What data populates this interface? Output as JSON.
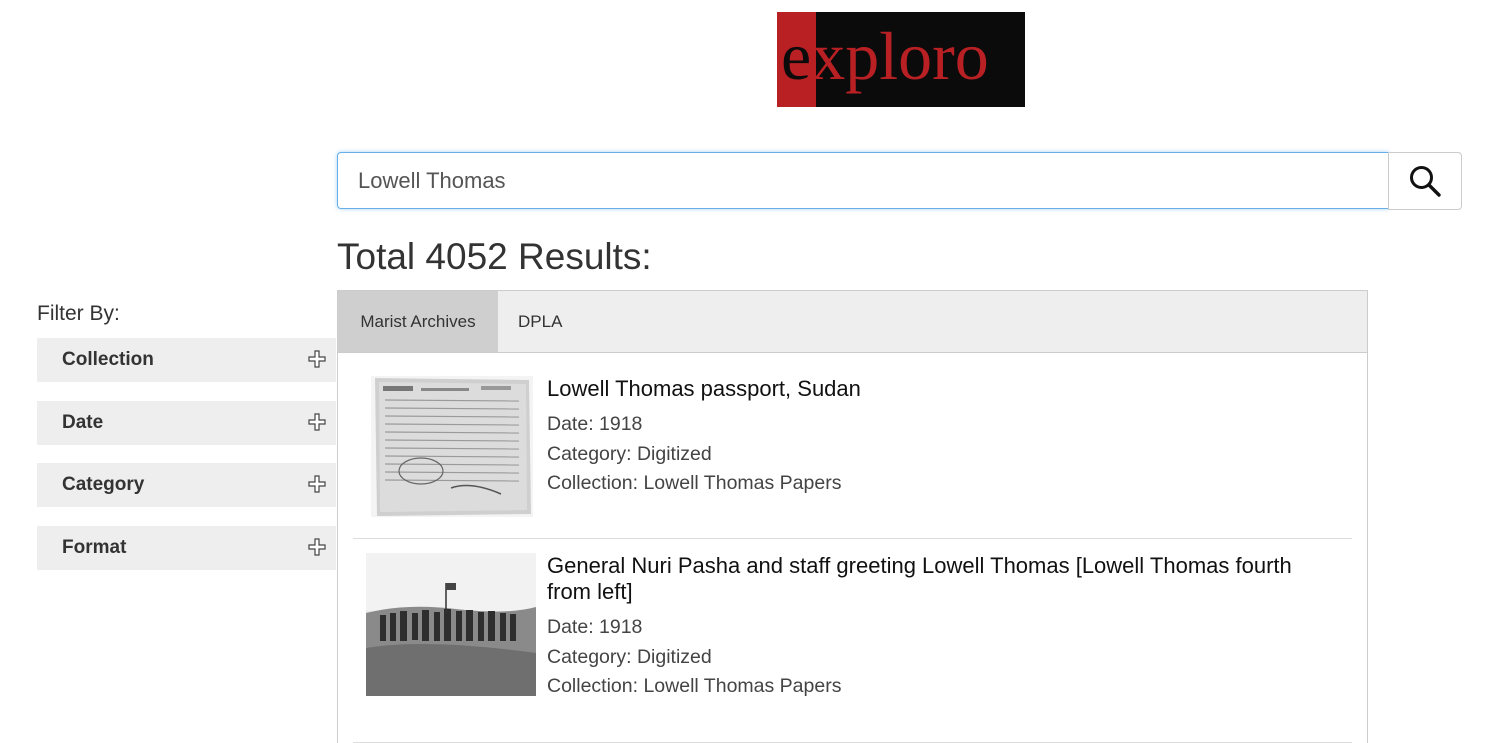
{
  "logo": {
    "first_letter": "e",
    "rest": "xploro",
    "colors": {
      "red": "#b82024",
      "black": "#0b0b0b"
    }
  },
  "search": {
    "value": "Lowell Thomas",
    "placeholder": "",
    "button_icon": "search-icon"
  },
  "results_heading": "Total 4052 Results:",
  "filter": {
    "title": "Filter By:",
    "items": [
      {
        "label": "Collection",
        "icon": "plus-icon"
      },
      {
        "label": "Date",
        "icon": "plus-icon"
      },
      {
        "label": "Category",
        "icon": "plus-icon"
      },
      {
        "label": "Format",
        "icon": "plus-icon"
      }
    ]
  },
  "tabs": [
    {
      "label": "Marist Archives",
      "active": true
    },
    {
      "label": "DPLA",
      "active": false
    }
  ],
  "results": [
    {
      "title": "Lowell Thomas passport, Sudan",
      "date": "Date: 1918",
      "category": "Category: Digitized",
      "collection": "Collection: Lowell Thomas Papers"
    },
    {
      "title": "General Nuri Pasha and staff greeting Lowell Thomas [Lowell Thomas fourth from left]",
      "date": "Date: 1918",
      "category": "Category: Digitized",
      "collection": "Collection: Lowell Thomas Papers"
    }
  ],
  "accent_color": "#66afe9"
}
